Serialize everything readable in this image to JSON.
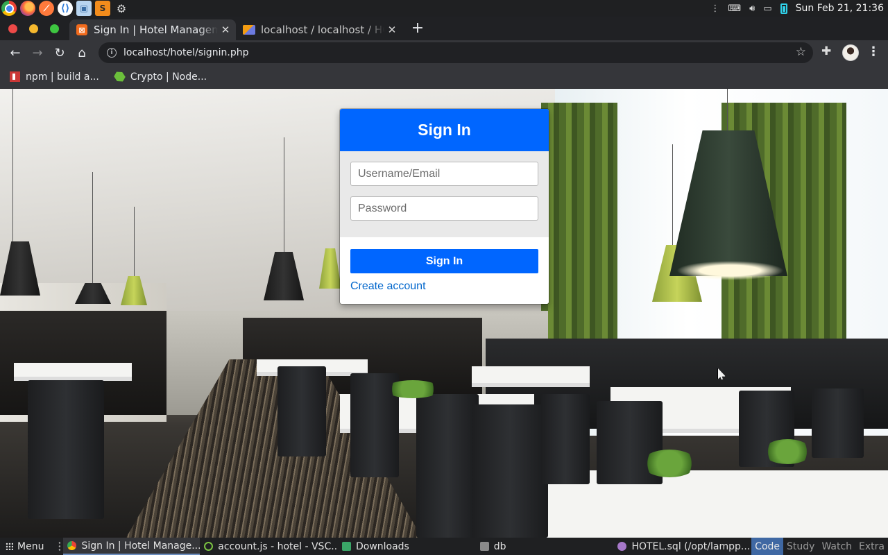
{
  "os_panel": {
    "clock": "Sun Feb 21, 21:36",
    "launchers": [
      "chrome-icon",
      "firefox-icon",
      "safari-icon",
      "vscode-icon",
      "virtualbox-icon",
      "sublime-icon",
      "settings-gear-icon"
    ],
    "sublime_letter": "S"
  },
  "browser": {
    "tabs": [
      {
        "title": "Sign In | Hotel Management",
        "active": true
      },
      {
        "title": "localhost / localhost / HOTEL",
        "active": false
      }
    ],
    "url": "localhost/hotel/signin.php",
    "bookmarks": [
      {
        "label": "npm | build a..."
      },
      {
        "label": "Crypto | Node..."
      }
    ]
  },
  "signin": {
    "title": "Sign In",
    "username_placeholder": "Username/Email",
    "password_placeholder": "Password",
    "submit_label": "Sign In",
    "create_account_label": "Create account",
    "accent_color": "#0066ff"
  },
  "taskbar": {
    "menu_label": "Menu",
    "tasks": [
      {
        "label": "Sign In | Hotel Manage...",
        "icon": "chrome-icon"
      },
      {
        "label": "account.js - hotel - VSC...",
        "icon": "vscode-icon"
      },
      {
        "label": "Downloads",
        "icon": "folder-icon"
      },
      {
        "label": "db",
        "icon": "folder-icon"
      },
      {
        "label": "HOTEL.sql (/opt/lampp...",
        "icon": "text-editor-icon"
      }
    ],
    "workspaces": [
      "Code",
      "Study",
      "Watch",
      "Extra"
    ],
    "active_workspace": "Code"
  }
}
